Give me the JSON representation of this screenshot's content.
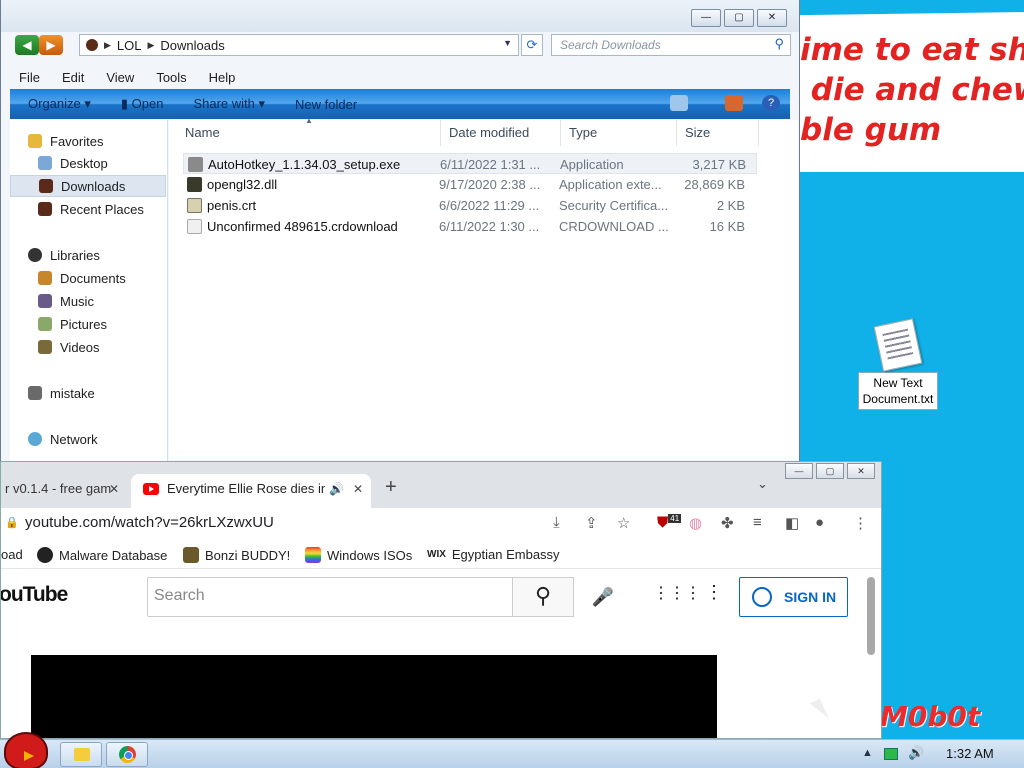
{
  "wallpaper": {
    "banner_lines": [
      "ime to eat shit",
      " die and chew",
      "ble gum"
    ],
    "mobot": "M0b0t"
  },
  "desktop_icons": [
    {
      "label": "New Text Document.txt",
      "icon": "text-file-icon"
    }
  ],
  "explorer": {
    "breadcrumb": [
      "LOL",
      "Downloads"
    ],
    "search_placeholder": "Search Downloads",
    "menu": [
      "File",
      "Edit",
      "View",
      "Tools",
      "Help"
    ],
    "commands": [
      "Organize",
      "Open",
      "Share with",
      "New folder"
    ],
    "nav": {
      "favorites_header": "Favorites",
      "favorites": [
        "Desktop",
        "Downloads",
        "Recent Places"
      ],
      "libraries_header": "Libraries",
      "libraries": [
        "Documents",
        "Music",
        "Pictures",
        "Videos"
      ],
      "other": [
        "mistake",
        "Network"
      ]
    },
    "columns": [
      "Name",
      "Date modified",
      "Type",
      "Size"
    ],
    "files": [
      {
        "name": "AutoHotkey_1.1.34.03_setup.exe",
        "date": "6/11/2022 1:31 ...",
        "type": "Application",
        "size": "3,217 KB"
      },
      {
        "name": "opengl32.dll",
        "date": "9/17/2020 2:38 ...",
        "type": "Application exte...",
        "size": "28,869 KB"
      },
      {
        "name": "penis.crt",
        "date": "6/6/2022 11:29 ...",
        "type": "Security Certifica...",
        "size": "2 KB"
      },
      {
        "name": "Unconfirmed 489615.crdownload",
        "date": "6/11/2022 1:30 ...",
        "type": "CRDOWNLOAD ...",
        "size": "16 KB"
      }
    ]
  },
  "chrome": {
    "tabs": [
      {
        "title": "r v0.1.4 - free gam"
      },
      {
        "title": "Everytime Ellie Rose dies in"
      }
    ],
    "url": "youtube.com/watch?v=26krLXzwxUU",
    "extension_badge": "41",
    "bookmarks": [
      "oad",
      "Malware Database",
      "Bonzi BUDDY!",
      "Windows ISOs",
      "Egyptian Embassy"
    ]
  },
  "youtube": {
    "logo": "ouTube",
    "search_placeholder": "Search",
    "signin": "SIGN IN"
  },
  "taskbar": {
    "clock": "1:32 AM"
  }
}
